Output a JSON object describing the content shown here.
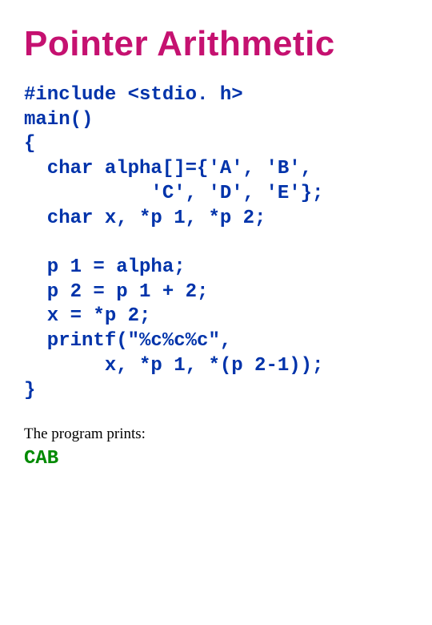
{
  "title": "Pointer Arithmetic",
  "code": "#include <stdio. h>\nmain()\n{\n  char alpha[]={'A', 'B',\n           'C', 'D', 'E'};\n  char x, *p 1, *p 2;\n\n  p 1 = alpha;\n  p 2 = p 1 + 2;\n  x = *p 2;\n  printf(\"%c%c%c\",\n       x, *p 1, *(p 2-1));\n}",
  "caption": "The program prints:",
  "output": "CAB"
}
